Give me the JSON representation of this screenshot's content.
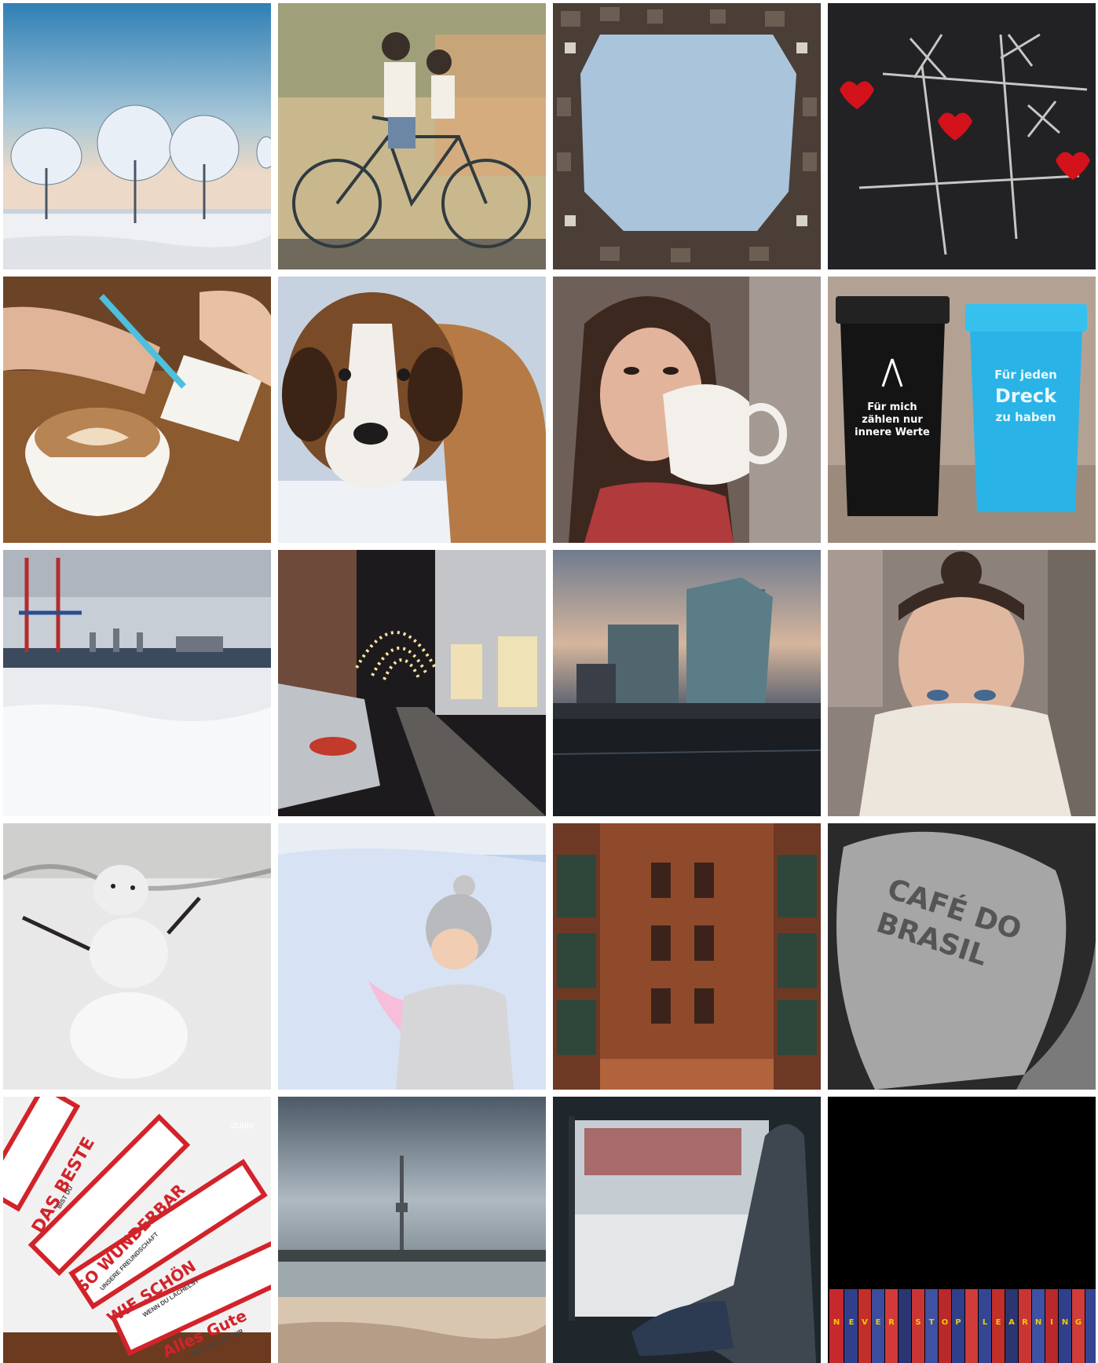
{
  "gallery": {
    "tiles": [
      {
        "subject": "frosted-trees"
      },
      {
        "subject": "bicycle-mural"
      },
      {
        "subject": "courtyard-sky"
      },
      {
        "subject": "tic-tac-toe-hearts"
      },
      {
        "subject": "cappuccino-writing"
      },
      {
        "subject": "snowy-dog"
      },
      {
        "subject": "woman-with-mug"
      },
      {
        "subject": "trash-bins"
      },
      {
        "subject": "frozen-harbor"
      },
      {
        "subject": "street-lights"
      },
      {
        "subject": "glass-office-buildings"
      },
      {
        "subject": "woman-sweater"
      },
      {
        "subject": "snowman"
      },
      {
        "subject": "child-in-snow"
      },
      {
        "subject": "brick-warehouse"
      },
      {
        "subject": "coffee-sack"
      },
      {
        "subject": "chocolate-bars"
      },
      {
        "subject": "tv-tower-lake"
      },
      {
        "subject": "woman-window"
      },
      {
        "subject": "book-spines"
      }
    ]
  },
  "texts": {
    "bin_black": [
      "Für mich",
      "zählen nur",
      "innere Werte"
    ],
    "bin_blue": [
      "Für jeden",
      "Dreck",
      "zu haben"
    ],
    "sack": [
      "CAFÉ DO",
      "BRASIL"
    ],
    "choc1": [
      "DAS BESTE",
      "BIST DU"
    ],
    "choc2": [
      "SO WUNDERBAR",
      "UNSERE FREUNDSCHAFT"
    ],
    "choc3": [
      "WIE SCHÖN",
      "WENN DU LÄCHELST"
    ],
    "choc4": [
      "Alles Gute",
      "WÜNSCHE ICH DIR"
    ],
    "brand": "duplo",
    "books": [
      "N",
      "E",
      "V",
      "E",
      "R",
      "",
      "S",
      "T",
      "O",
      "P",
      "",
      "L",
      "E",
      "A",
      "R",
      "N",
      "I",
      "N",
      "G"
    ]
  }
}
